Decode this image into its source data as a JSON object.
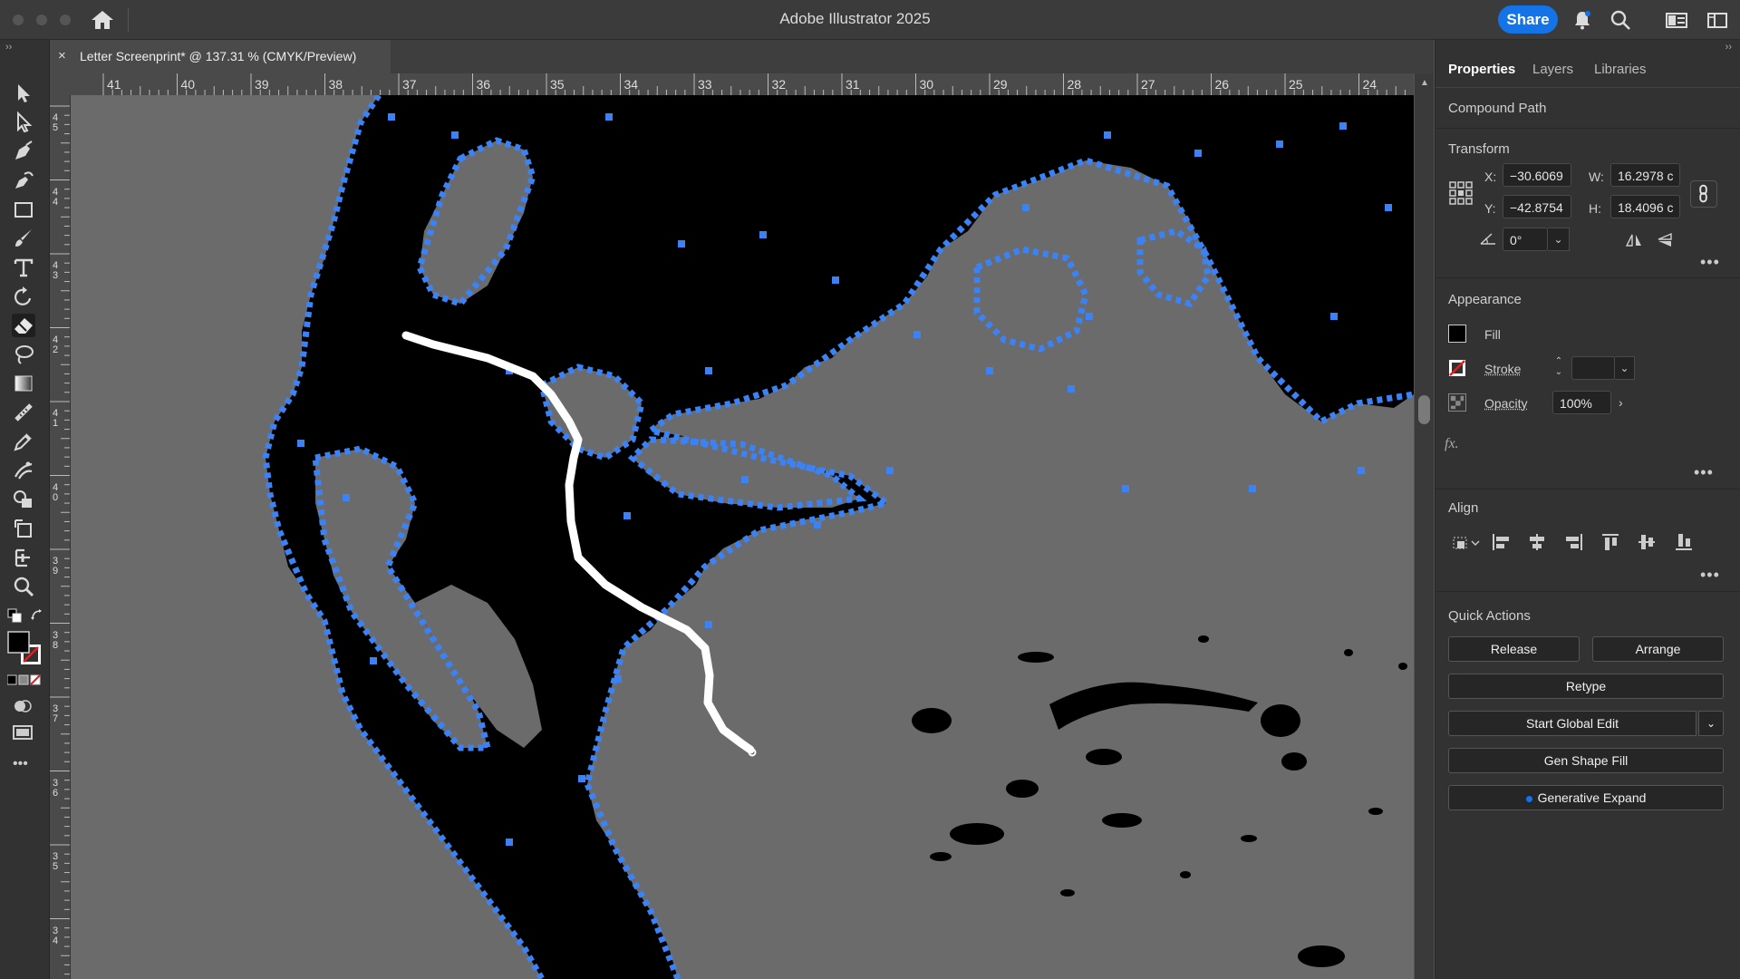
{
  "window": {
    "title": "Adobe Illustrator 2025",
    "share_label": "Share",
    "accent": "#1473e6"
  },
  "document_tab": {
    "close_glyph": "×",
    "label": "Letter Screenprint* @ 137.31 % (CMYK/Preview)"
  },
  "rulers": {
    "top": [
      "41",
      "40",
      "39",
      "38",
      "37",
      "36",
      "35",
      "34",
      "33",
      "32",
      "31",
      "30",
      "29",
      "28",
      "27",
      "26",
      "25",
      "24"
    ],
    "left": [
      "4\n5",
      "4\n4",
      "4\n3",
      "4\n2",
      "4\n1",
      "4\n0",
      "3\n9",
      "3\n8",
      "3\n7",
      "3\n6",
      "3\n5",
      "3\n4"
    ]
  },
  "toolbar": {
    "tools": [
      "selection-tool-icon",
      "direct-selection-tool-icon",
      "pen-tool-icon",
      "curvature-tool-icon",
      "rectangle-tool-icon",
      "paintbrush-tool-icon",
      "type-tool-icon",
      "rotate-tool-icon",
      "eraser-tool-icon",
      "lasso-tool-icon",
      "gradient-tool-icon",
      "measure-tool-icon",
      "eyedropper-tool-icon",
      "puppet-warp-tool-icon",
      "shape-builder-tool-icon",
      "artboard-tool-icon",
      "width-tool-icon",
      "zoom-tool-icon"
    ],
    "active_tool": "eraser-tool-icon",
    "more_glyph": "•••"
  },
  "panel": {
    "tabs": [
      "Properties",
      "Layers",
      "Libraries"
    ],
    "active_tab": "Properties",
    "selection_type": "Compound Path",
    "transform": {
      "heading": "Transform",
      "x_label": "X:",
      "x_value": "−30.6069",
      "y_label": "Y:",
      "y_value": "−42.8754",
      "w_label": "W:",
      "w_value": "16.2978 c",
      "h_label": "H:",
      "h_value": "18.4096 c",
      "angle_value": "0°"
    },
    "appearance": {
      "heading": "Appearance",
      "fill_label": "Fill",
      "stroke_label": "Stroke",
      "opacity_label": "Opacity",
      "opacity_value": "100%",
      "fx_label": "fx."
    },
    "align": {
      "heading": "Align"
    },
    "quick_actions": {
      "heading": "Quick Actions",
      "release": "Release",
      "arrange": "Arrange",
      "retype": "Retype",
      "start_global_edit": "Start Global Edit",
      "gen_shape_fill": "Gen Shape Fill",
      "generative_expand": "Generative Expand"
    },
    "more_glyph": "•••"
  },
  "colors": {
    "selection_blue": "#3b82f6",
    "canvas_gray": "#6b6b6b",
    "artwork": "#000000",
    "eraser_path": "#ffffff"
  }
}
